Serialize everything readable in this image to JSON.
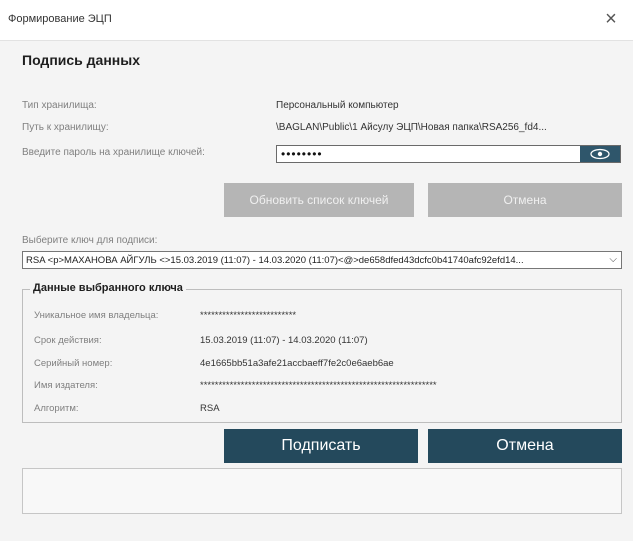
{
  "window": {
    "title": "Формирование ЭЦП",
    "close": "×"
  },
  "heading": "Подпись данных",
  "storage": {
    "type_label": "Тип хранилища:",
    "type_value": "Персональный компьютер",
    "path_label": "Путь к хранилищу:",
    "path_value": "\\BAGLAN\\Public\\1 Айсулу ЭЦП\\Новая папка\\RSA256_fd4...",
    "password_label": "Введите пароль на хранилище ключей:",
    "password_value": "••••••••"
  },
  "buttons": {
    "refresh_keys": "Обновить список ключей",
    "cancel_top": "Отмена",
    "sign": "Подписать",
    "cancel_bottom": "Отмена"
  },
  "key_select": {
    "label": "Выберите ключ для подписи:",
    "value": "RSA <p>МАХАНОВА АЙГУЛЬ <>15.03.2019 (11:07) - 14.03.2020 (11:07)<@>de658dfed43dcfc0b41740afc92efd14..."
  },
  "key_details": {
    "title": "Данные выбранного ключа",
    "owner_label": "Уникальное имя владельца:",
    "owner_value": "**************************",
    "validity_label": "Срок действия:",
    "validity_value": "15.03.2019 (11:07) - 14.03.2020 (11:07)",
    "serial_label": "Серийный номер:",
    "serial_value": "4e1665bb51a3afe21accbaeff7fe2c0e6aeb6ae",
    "issuer_label": "Имя издателя:",
    "issuer_value": "****************************************************************",
    "algorithm_label": "Алгоритм:",
    "algorithm_value": "RSA"
  },
  "icons": {
    "eye": "eye-icon",
    "chevron": "chevron-down-icon",
    "close": "close-icon"
  },
  "colors": {
    "primary": "#24495c",
    "disabled": "#b5b5b5",
    "background": "#f4f4f4"
  }
}
